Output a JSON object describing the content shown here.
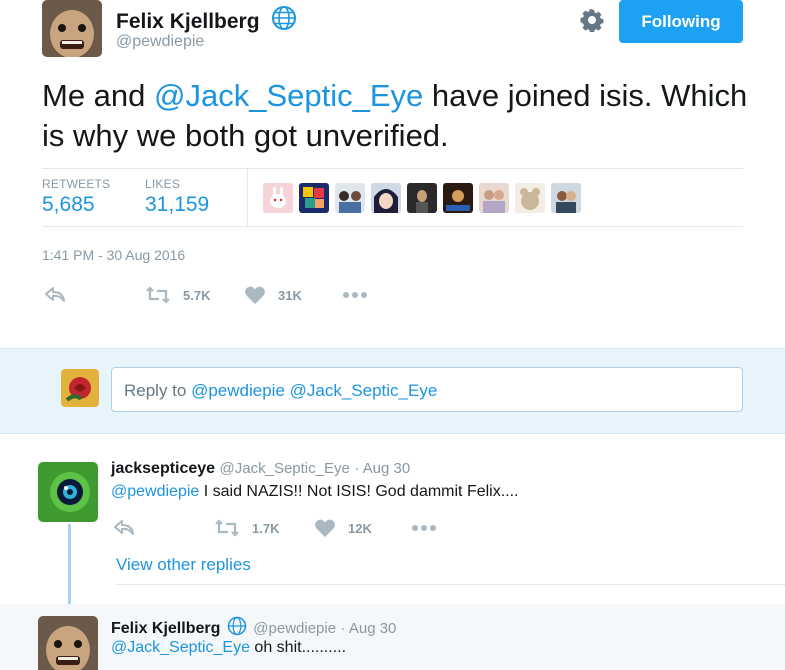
{
  "tweet": {
    "author_name": "Felix Kjellberg",
    "author_handle": "@pewdiepie",
    "follow_label": "Following",
    "text_before": "Me and ",
    "text_mention": "@Jack_Septic_Eye",
    "text_after": " have joined isis. Which is why we both got unverified.",
    "retweets_label": "RETWEETS",
    "retweets_value": "5,685",
    "likes_label": "LIKES",
    "likes_value": "31,159",
    "timestamp": "1:41 PM - 30 Aug 2016",
    "retweet_count": "5.7K",
    "like_count": "31K",
    "liker_avatars": [
      "bunny-avatar",
      "puzzle-avatar",
      "group-avatar",
      "anime-avatar",
      "dark-avatar",
      "game-avatar",
      "couple-avatar",
      "plush-avatar",
      "person-avatar"
    ]
  },
  "reply_box": {
    "prefix": "Reply to ",
    "mentions": "@pewdiepie @Jack_Septic_Eye"
  },
  "replies": [
    {
      "name": "jacksepticeye",
      "handle": "@Jack_Septic_Eye",
      "time": "· Aug 30",
      "mention": "@pewdiepie",
      "text": " I said NAZIS!! Not ISIS! God dammit Felix....",
      "retweet_count": "1.7K",
      "like_count": "12K"
    },
    {
      "name": "Felix Kjellberg",
      "handle": "@pewdiepie",
      "time": "· Aug 30",
      "mention": "@Jack_Septic_Eye",
      "text": " oh shit.........."
    }
  ],
  "view_other_replies": "View other replies",
  "colors": {
    "accent": "#1da1f2",
    "link": "#1b95e0",
    "muted": "#8899a6"
  }
}
